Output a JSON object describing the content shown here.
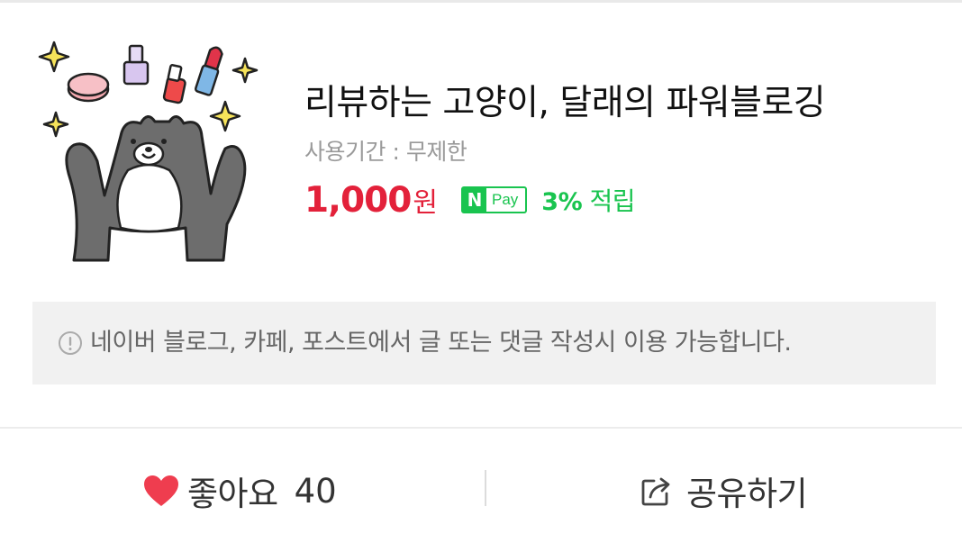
{
  "product": {
    "title": "리뷰하는 고양이, 달래의 파워블로깅",
    "period": "사용기간 : 무제한",
    "price": "1,000",
    "price_unit": "원",
    "npay": {
      "n": "N",
      "pay": "Pay"
    },
    "reward_percent": "3%",
    "reward_label": "적립",
    "image_icon": "cat-with-cosmetics-sticker"
  },
  "notice": {
    "icon": "info-circle-icon",
    "text": "네이버 블로그, 카페, 포스트에서 글 또는 댓글 작성시 이용 가능합니다."
  },
  "actions": {
    "like_label": "좋아요",
    "like_count": "40",
    "share_label": "공유하기"
  },
  "colors": {
    "price": "#e3213a",
    "npay_green": "#19c44f",
    "heart": "#ef3d4f",
    "notice_bg": "#f1f1f1"
  }
}
